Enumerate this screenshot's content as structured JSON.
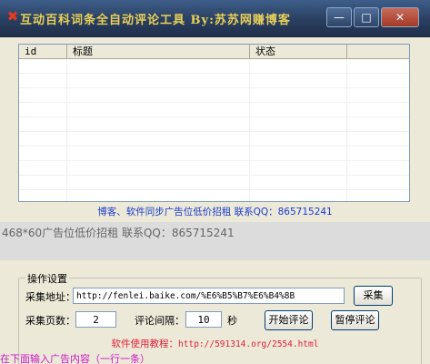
{
  "window": {
    "title": "互动百科词条全自动评论工具    By:苏苏网赚博客",
    "controls": {
      "minimize": "—",
      "maximize": "□",
      "close": "✕"
    }
  },
  "table": {
    "columns": [
      "id",
      "标题",
      "状态"
    ]
  },
  "promo": {
    "line1": "博客、软件同步广告位低价招租  联系QQ：865715241",
    "line2": "468*60广告位低价招租 联系QQ：865715241"
  },
  "settings": {
    "legend": "操作设置",
    "collect_url_label": "采集地址：",
    "collect_url_value": "http://fenlei.baike.com/%E6%B5%B7%E6%B4%8B",
    "collect_button": "采集",
    "pages_label": "采集页数：",
    "pages_value": "2",
    "interval_label": "评论间隔：",
    "interval_value": "10",
    "interval_unit": "秒",
    "start_button": "开始评论",
    "pause_button": "暂停评论"
  },
  "footer": {
    "tutorial_label": "软件使用教程：",
    "tutorial_url": "http://591314.org/2554.html",
    "ad_hint": "在下面输入广告内容（一行一条）"
  }
}
